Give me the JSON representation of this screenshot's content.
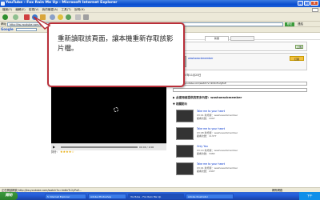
{
  "window": {
    "title": "YouTube - Fox Rain Me Up - Microsoft Internet Explorer"
  },
  "menu": [
    "檔案(F)",
    "編輯(E)",
    "檢視(V)",
    "我的最愛(A)",
    "工具(T)",
    "說明(H)"
  ],
  "address": {
    "label": "網址",
    "url": "http://tw.youtube.com/watch?v=lm6nTL2yPuE",
    "go_label": "移至",
    "links_label": "連結"
  },
  "google": {
    "label": "Google"
  },
  "callout": {
    "text": "重新讀取該頁面，讓本機重新存取該影片檔。"
  },
  "page": {
    "tab_label": "新聞",
    "upload_label": "上傳",
    "subscribe_label": "訂閱",
    "channel_name": "washoeacbmember",
    "video_time": "00:00 / 2:00",
    "rating_label": "評分：",
    "rating_stars": "★★★★☆",
    "added_line": "新增於2007年11月23日",
    "more_from": "▶ 此使用者提供的更多內容：washoeacbmember",
    "related_head": "▼ 相關影片",
    "related": [
      {
        "title": "Take me to your heart",
        "meta": "03:01 新增者：washoeacbmember",
        "views": "觀看次數：1997"
      },
      {
        "title": "Take me to your heart",
        "meta": "03:08 新增者：washoeacbmember",
        "views": "觀看次數：11377"
      },
      {
        "title": "Only You",
        "meta": "03:14 新增者：washoeacbmember",
        "views": "觀看次數：3482"
      },
      {
        "title": "Take me to your heart",
        "meta": "03:01 新增者：washoeacbmember",
        "views": "觀看次數：2407"
      }
    ]
  },
  "status": {
    "text": "正在開啟網頁 http://tw.youtube.com/watch?v=lm6nTL2yPuE...",
    "zone": "網際網路"
  },
  "taskbar": {
    "start": "開始",
    "tasks": [
      "5 Internet Explorer",
      "Adobe Photoshop",
      "YouTube - Fox Rain Me Up",
      "Adobe Illustrator"
    ],
    "clock": "下午"
  },
  "colors": {
    "callout_border": "#b9303a",
    "titlebar": "#0a4ecf",
    "taskbar": "#245edb",
    "start": "#2b7f2b"
  }
}
